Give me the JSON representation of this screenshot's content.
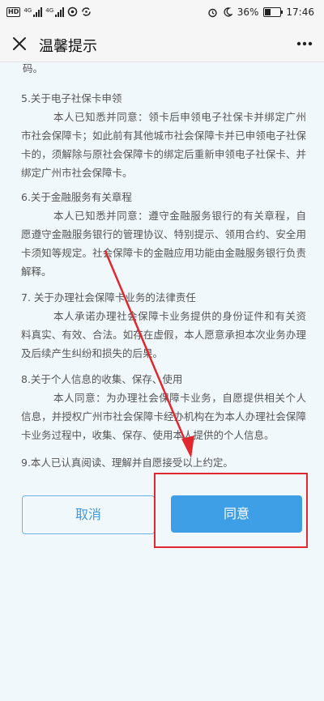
{
  "status_bar": {
    "hd_label": "HD",
    "network_1": "4G",
    "network_2": "4G",
    "battery_percent": "36%",
    "time": "17:46",
    "battery_level": 0.36
  },
  "header": {
    "title": "温馨提示",
    "close_icon": "close-icon",
    "more_icon": "more-icon"
  },
  "content": {
    "fragment": "码。",
    "sections": [
      {
        "heading": "5.关于电子社保卡申领",
        "body": "本人已知悉并同意：领卡后申领电子社保卡并绑定广州市社会保障卡；如此前有其他城市社会保障卡并已申领电子社保卡的，须解除与原社会保障卡的绑定后重新申领电子社保卡、并绑定广州市社会保障卡。"
      },
      {
        "heading": "6.关于金融服务有关章程",
        "body": "本人已知悉并同意：遵守金融服务银行的有关章程，自愿遵守金融服务银行的管理协议、特别提示、领用合约、安全用卡须知等规定。社会保障卡的金融应用功能由金融服务银行负责解释。"
      },
      {
        "heading": "7. 关于办理社会保障卡业务的法律责任",
        "body": "本人承诺办理社会保障卡业务提供的身份证件和有关资料真实、有效、合法。如存在虚假，本人愿意承担本次业务办理及后续产生纠纷和损失的后果。"
      },
      {
        "heading": "8.关于个人信息的收集、保存、使用",
        "body": "本人同意：为办理社会保障卡业务，自愿提供相关个人信息，并授权广州市社会保障卡经办机构在为本人办理社会保障卡业务过程中，收集、保存、使用本人提供的个人信息。"
      },
      {
        "heading": "9.本人已认真阅读、理解并自愿接受以上约定。",
        "body": ""
      }
    ]
  },
  "actions": {
    "cancel_label": "取消",
    "agree_label": "同意"
  },
  "colors": {
    "accent": "#3f9fe6",
    "annotation": "#e0282e",
    "background": "#f1f8fc"
  }
}
